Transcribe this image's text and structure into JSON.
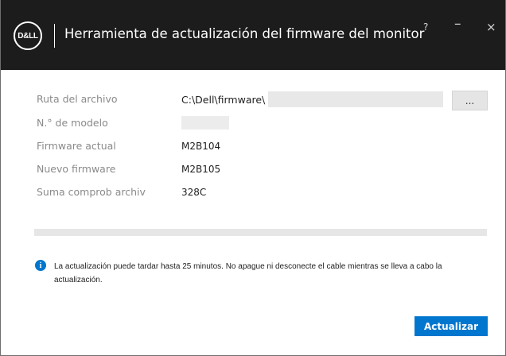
{
  "titlebar": {
    "logo": "D&LL",
    "title": "Herramienta de actualización del firmware del monitor",
    "help": "?",
    "minimize": "–",
    "close": "×"
  },
  "fields": {
    "path_label": "Ruta del archivo",
    "path_value": "C:\\Dell\\firmware\\",
    "browse_label": "...",
    "model_label": "N.° de modelo",
    "current_label": "Firmware actual",
    "current_value": "M2B104",
    "new_label": "Nuevo firmware",
    "new_value": "M2B105",
    "checksum_label": "Suma comprob archiv",
    "checksum_value": "328C"
  },
  "progress": {
    "value": 0
  },
  "info": {
    "icon": "info-icon",
    "text": "La actualización puede tardar hasta 25 minutos. No apague ni desconecte el cable mientras se lleva a cabo la actualización."
  },
  "actions": {
    "update_label": "Actualizar"
  },
  "colors": {
    "accent": "#0076ce",
    "titlebar": "#1c1c1c"
  }
}
